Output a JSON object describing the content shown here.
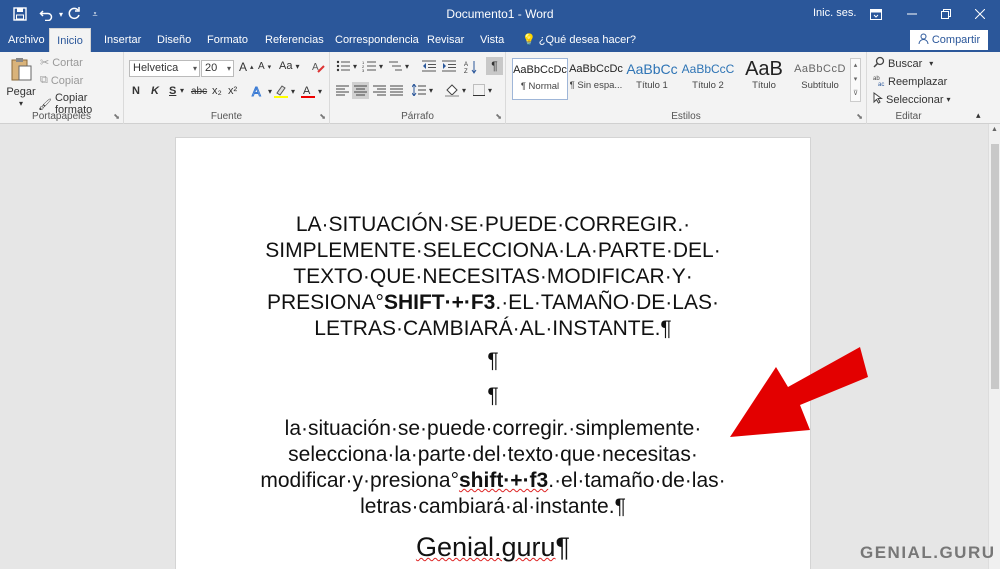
{
  "window": {
    "title": "Documento1 - Word",
    "signin": "Inic. ses.",
    "quick_access": [
      "save-icon",
      "undo-icon",
      "redo-icon",
      "customize-icon"
    ]
  },
  "tabs": [
    "Archivo",
    "Inicio",
    "Insertar",
    "Diseño",
    "Formato",
    "Referencias",
    "Correspondencia",
    "Revisar",
    "Vista"
  ],
  "active_tab": "Inicio",
  "tellme": "¿Qué desea hacer?",
  "share": "Compartir",
  "ribbon": {
    "clipboard": {
      "paste": "Pegar",
      "cut": "Cortar",
      "copy": "Copiar",
      "format_painter": "Copiar formato",
      "label": "Portapapeles"
    },
    "font": {
      "family": "Helvetica",
      "size": "20",
      "bold": "N",
      "italic": "K",
      "underline": "S",
      "strike": "abc",
      "subscript": "x₂",
      "superscript": "x²",
      "grow": "A",
      "shrink": "A",
      "case": "Aa",
      "label": "Fuente"
    },
    "paragraph": {
      "label": "Párrafo",
      "pilcrow": "¶"
    },
    "styles": {
      "label": "Estilos",
      "items": [
        {
          "preview": "AaBbCcDc",
          "name": "¶ Normal"
        },
        {
          "preview": "AaBbCcDc",
          "name": "¶ Sin espa..."
        },
        {
          "preview": "AaBbCc",
          "name": "Título 1"
        },
        {
          "preview": "AaBbCcC",
          "name": "Título 2"
        },
        {
          "preview": "AaB",
          "name": "Título"
        },
        {
          "preview": "AaBbCcD",
          "name": "Subtítulo"
        }
      ]
    },
    "editing": {
      "label": "Editar",
      "find": "Buscar",
      "replace": "Reemplazar",
      "select": "Seleccionar"
    }
  },
  "document": {
    "p1": {
      "line1": "LA·SITUACIÓN·SE·PUEDE·CORREGIR.·",
      "line2": "SIMPLEMENTE·SELECCIONA·LA·PARTE·DEL·",
      "line3": "TEXTO·QUE·NECESITAS·MODIFICAR·Y·",
      "line4_pre": "PRESIONA°",
      "line4_bold": "SHIFT·+·F3",
      "line4_post": ".·EL·TAMAÑO·DE·LAS·",
      "line5": "LETRAS·CAMBIARÁ·AL·INSTANTE.¶"
    },
    "empty_mark_1": "¶",
    "empty_mark_2": "¶",
    "p2": {
      "line1": "la·situación·se·puede·corregir.·simplemente·",
      "line2": "selecciona·la·parte·del·texto·que·necesitas·",
      "line3_pre": "modificar·y·presiona°",
      "line3_bold": "shift·+·f3",
      "line3_post": ".·el·tamaño·de·las·",
      "line4": "letras·cambiará·al·instante.¶"
    },
    "p3": {
      "word": "Genial.guru",
      "mark": "¶"
    }
  },
  "watermark": "GENIAL.GURU",
  "colors": {
    "ribbon_blue": "#2b579a",
    "arrow_red": "#e30000"
  }
}
